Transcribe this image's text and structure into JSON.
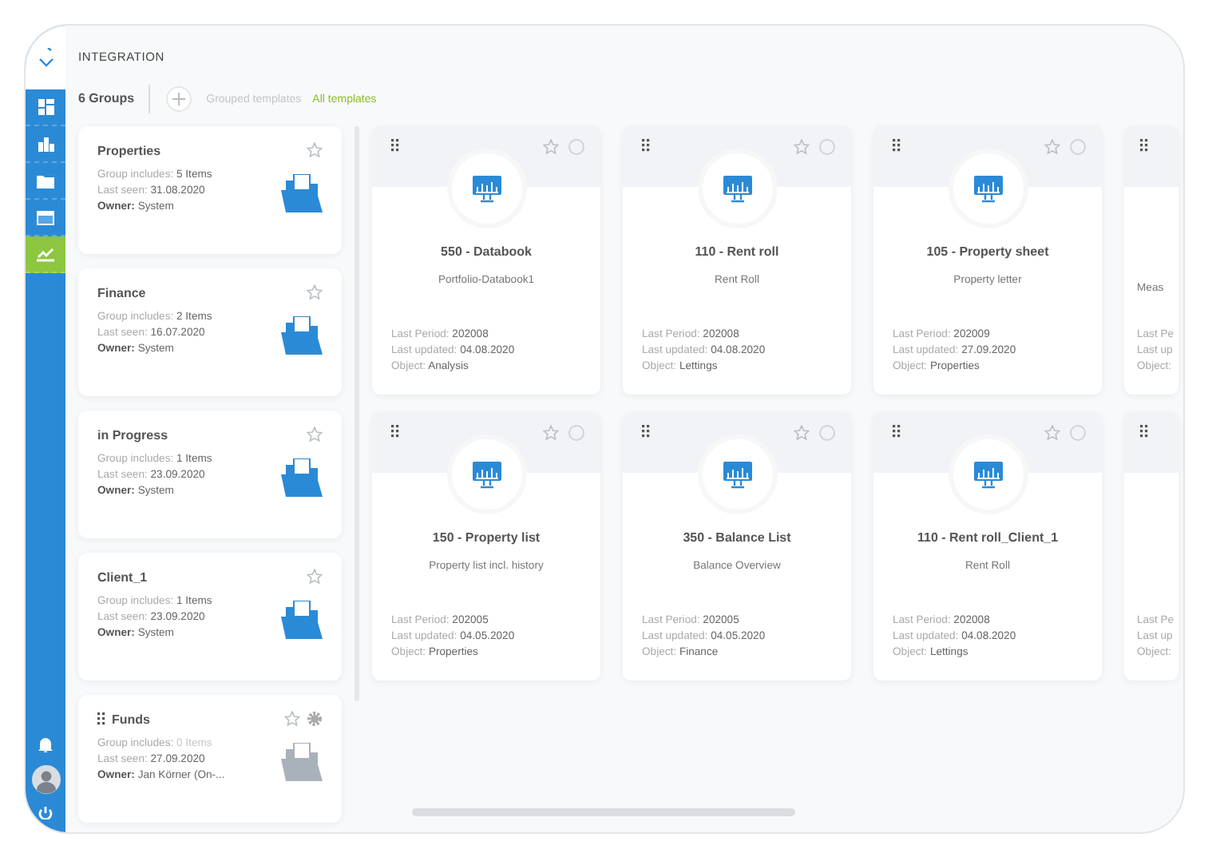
{
  "sidebar": {
    "items": [
      {
        "kind": "dashboard",
        "selected": false
      },
      {
        "kind": "chart",
        "selected": false
      },
      {
        "kind": "folder",
        "selected": false
      },
      {
        "kind": "table",
        "selected": false
      },
      {
        "kind": "trend",
        "selected": true
      }
    ],
    "bottom": [
      {
        "kind": "bell"
      },
      {
        "kind": "avatar"
      },
      {
        "kind": "power"
      }
    ]
  },
  "header": {
    "title": "INTEGRATION"
  },
  "toolbar": {
    "count": "6 Groups",
    "tabs": [
      {
        "label": "Grouped templates",
        "selected": false
      },
      {
        "label": "All templates",
        "selected": true
      }
    ]
  },
  "groups": [
    {
      "name": "Properties",
      "includes_label": "Group includes:",
      "includes": "5 Items",
      "seen_label": "Last seen:",
      "seen": "31.08.2020",
      "owner_label": "Owner:",
      "owner": "System",
      "draggable": false,
      "settings": false,
      "empty": false
    },
    {
      "name": "Finance",
      "includes_label": "Group includes:",
      "includes": "2 Items",
      "seen_label": "Last seen:",
      "seen": "16.07.2020",
      "owner_label": "Owner:",
      "owner": "System",
      "draggable": false,
      "settings": false,
      "empty": false
    },
    {
      "name": "in Progress",
      "includes_label": "Group includes:",
      "includes": "1 Items",
      "seen_label": "Last seen:",
      "seen": "23.09.2020",
      "owner_label": "Owner:",
      "owner": "System",
      "draggable": false,
      "settings": false,
      "empty": false
    },
    {
      "name": "Client_1",
      "includes_label": "Group includes:",
      "includes": "1 Items",
      "seen_label": "Last seen:",
      "seen": "23.09.2020",
      "owner_label": "Owner:",
      "owner": "System",
      "draggable": false,
      "settings": false,
      "empty": false
    },
    {
      "name": "Funds",
      "includes_label": "Group includes:",
      "includes": "0 Items",
      "seen_label": "Last seen:",
      "seen": "27.09.2020",
      "owner_label": "Owner:",
      "owner": "Jan Körner (On-...",
      "draggable": true,
      "settings": true,
      "empty": true
    }
  ],
  "template_rows": [
    {
      "cards": [
        {
          "kind": "full",
          "selected": false,
          "title": "550 - Databook",
          "subtitle": "Portfolio-Databook1",
          "fields": [
            {
              "label": "Last Period:",
              "value": "202008"
            },
            {
              "label": "Last updated:",
              "value": "04.08.2020"
            },
            {
              "label": "Object:",
              "value": "Analysis"
            }
          ]
        },
        {
          "kind": "full",
          "selected": false,
          "title": "110 - Rent roll",
          "subtitle": "Rent Roll",
          "fields": [
            {
              "label": "Last Period:",
              "value": "202008"
            },
            {
              "label": "Last updated:",
              "value": "04.08.2020"
            },
            {
              "label": "Object:",
              "value": "Lettings"
            }
          ]
        },
        {
          "kind": "full",
          "selected": false,
          "title": "105 - Property sheet",
          "subtitle": "Property letter",
          "fields": [
            {
              "label": "Last Period:",
              "value": "202009"
            },
            {
              "label": "Last updated:",
              "value": "27.09.2020"
            },
            {
              "label": "Object:",
              "value": "Properties"
            }
          ]
        },
        {
          "kind": "partial",
          "subtitle": "Meas",
          "fields": [
            {
              "label": "Last Pe"
            },
            {
              "label": "Last up"
            },
            {
              "label": "Object:"
            }
          ]
        }
      ]
    },
    {
      "cards": [
        {
          "kind": "full",
          "selected": false,
          "title": "150 - Property list",
          "subtitle": "Property list incl. history",
          "fields": [
            {
              "label": "Last Period:",
              "value": "202005"
            },
            {
              "label": "Last updated:",
              "value": "04.05.2020"
            },
            {
              "label": "Object:",
              "value": "Properties"
            }
          ]
        },
        {
          "kind": "full",
          "selected": false,
          "title": "350 - Balance List",
          "subtitle": "Balance Overview",
          "fields": [
            {
              "label": "Last Period:",
              "value": "202005"
            },
            {
              "label": "Last updated:",
              "value": "04.05.2020"
            },
            {
              "label": "Object:",
              "value": "Finance"
            }
          ]
        },
        {
          "kind": "full",
          "selected": false,
          "title": "110 - Rent roll_Client_1",
          "subtitle": "Rent Roll",
          "fields": [
            {
              "label": "Last Period:",
              "value": "202008"
            },
            {
              "label": "Last updated:",
              "value": "04.08.2020"
            },
            {
              "label": "Object:",
              "value": "Lettings"
            }
          ]
        },
        {
          "kind": "partial",
          "fields": [
            {
              "label": "Last Pe"
            },
            {
              "label": "Last up"
            },
            {
              "label": "Object:"
            }
          ]
        }
      ]
    }
  ]
}
